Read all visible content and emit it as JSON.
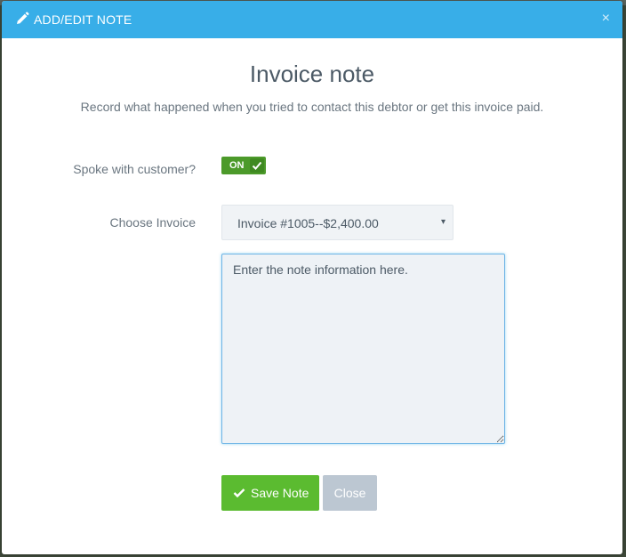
{
  "header": {
    "title": "ADD/EDIT NOTE",
    "close_glyph": "×",
    "icon": "pencil-icon"
  },
  "main": {
    "title": "Invoice note",
    "subtitle": "Record what happened when you tried to contact this debtor or get this invoice paid."
  },
  "form": {
    "spoke_label": "Spoke with customer?",
    "spoke_toggle": {
      "label": "ON",
      "state": "on",
      "icon": "check-icon"
    },
    "invoice_label": "Choose Invoice",
    "invoice_select": {
      "value": "Invoice #1005--$2,400.00",
      "caret": "▾"
    },
    "note": {
      "placeholder": "Enter the note information here.",
      "value": ""
    }
  },
  "actions": {
    "save_label": "Save Note",
    "close_label": "Close"
  },
  "colors": {
    "header": "#38aee8",
    "toggle": "#4c9a2a",
    "save": "#5bbb30",
    "close": "#bcc7d2"
  }
}
